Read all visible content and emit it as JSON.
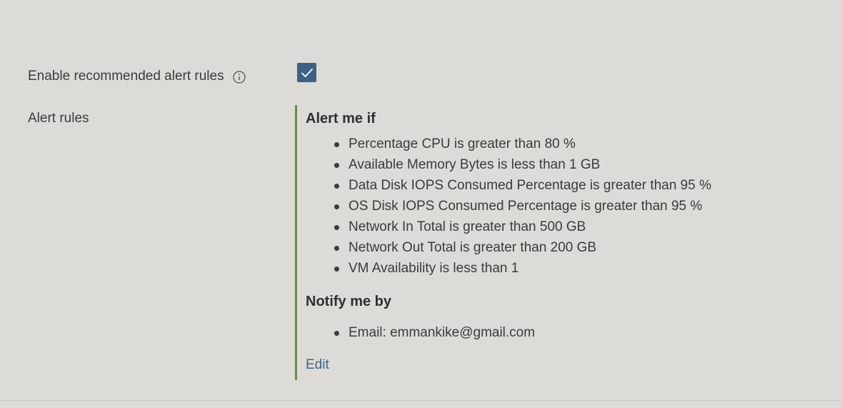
{
  "enable_row": {
    "label": "Enable recommended alert rules",
    "info_icon": "info-circle-icon",
    "checked": true
  },
  "rules_row": {
    "label": "Alert rules"
  },
  "alert_section": {
    "heading": "Alert me if",
    "items": [
      "Percentage CPU is greater than 80 %",
      "Available Memory Bytes is less than 1 GB",
      "Data Disk IOPS Consumed Percentage is greater than 95 %",
      "OS Disk IOPS Consumed Percentage is greater than 95 %",
      "Network In Total is greater than 500 GB",
      "Network Out Total is greater than 200 GB",
      "VM Availability is less than 1"
    ]
  },
  "notify_section": {
    "heading": "Notify me by",
    "items": [
      "Email: emmankike@gmail.com"
    ]
  },
  "edit_link": "Edit",
  "colors": {
    "checkbox": "#3d6185",
    "accent_border": "#6b8e3d",
    "link": "#3d6589",
    "background": "#dcdbd7"
  }
}
